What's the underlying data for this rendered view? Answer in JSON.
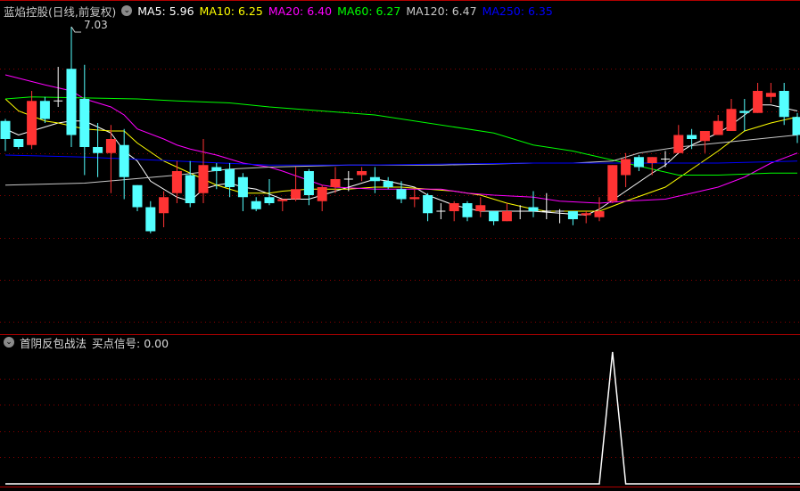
{
  "header": {
    "title": "蓝焰控股(日线,前复权)",
    "ma": [
      {
        "label": "MA5: 5.96",
        "color": "#ffffff"
      },
      {
        "label": "MA10: 6.25",
        "color": "#ffff00"
      },
      {
        "label": "MA20: 6.40",
        "color": "#ff00ff"
      },
      {
        "label": "MA60: 6.27",
        "color": "#00ff00"
      },
      {
        "label": "MA120: 6.47",
        "color": "#c8c8c8"
      },
      {
        "label": "MA250: 6.35",
        "color": "#0000ff"
      }
    ]
  },
  "high_marker": "7.03",
  "indicator": {
    "name": "首阴反包战法",
    "signal_label": "买点信号: 0.00",
    "signal_index": 46
  },
  "colors": {
    "up": "#ff3333",
    "down": "#54ffff",
    "doji": "#ffffff",
    "grid": "#8b0000",
    "divider": "#b00000"
  },
  "chart_data": {
    "type": "candlestick",
    "ylim": [
      5.97,
      7.1
    ],
    "candles": [
      [
        6.56,
        6.57,
        6.41,
        6.47
      ],
      [
        6.47,
        6.47,
        6.42,
        6.43
      ],
      [
        6.44,
        6.71,
        6.42,
        6.66
      ],
      [
        6.66,
        6.68,
        6.55,
        6.57
      ],
      [
        6.66,
        6.83,
        6.63,
        6.66
      ],
      [
        6.82,
        7.03,
        6.43,
        6.49
      ],
      [
        6.67,
        6.84,
        6.29,
        6.43
      ],
      [
        6.43,
        6.55,
        6.28,
        6.4
      ],
      [
        6.4,
        6.54,
        6.2,
        6.47
      ],
      [
        6.44,
        6.52,
        6.17,
        6.28
      ],
      [
        6.24,
        6.24,
        6.11,
        6.13
      ],
      [
        6.13,
        6.16,
        6.0,
        6.01
      ],
      [
        6.1,
        6.21,
        6.03,
        6.18
      ],
      [
        6.2,
        6.36,
        6.15,
        6.31
      ],
      [
        6.29,
        6.36,
        6.13,
        6.15
      ],
      [
        6.2,
        6.47,
        6.15,
        6.34
      ],
      [
        6.33,
        6.35,
        6.22,
        6.31
      ],
      [
        6.32,
        6.35,
        6.18,
        6.23
      ],
      [
        6.28,
        6.3,
        6.11,
        6.18
      ],
      [
        6.16,
        6.18,
        6.11,
        6.12
      ],
      [
        6.18,
        6.27,
        6.14,
        6.15
      ],
      [
        6.16,
        6.17,
        6.11,
        6.17
      ],
      [
        6.17,
        6.33,
        6.16,
        6.22
      ],
      [
        6.31,
        6.32,
        6.14,
        6.19
      ],
      [
        6.16,
        6.24,
        6.11,
        6.23
      ],
      [
        6.23,
        6.33,
        6.2,
        6.27
      ],
      [
        6.27,
        6.31,
        6.21,
        6.27
      ],
      [
        6.29,
        6.33,
        6.26,
        6.31
      ],
      [
        6.28,
        6.33,
        6.2,
        6.26
      ],
      [
        6.26,
        6.28,
        6.22,
        6.23
      ],
      [
        6.22,
        6.26,
        6.15,
        6.17
      ],
      [
        6.17,
        6.22,
        6.13,
        6.18
      ],
      [
        6.19,
        6.2,
        6.06,
        6.1
      ],
      [
        6.11,
        6.15,
        6.07,
        6.11
      ],
      [
        6.11,
        6.16,
        6.06,
        6.15
      ],
      [
        6.15,
        6.16,
        6.06,
        6.08
      ],
      [
        6.11,
        6.18,
        6.08,
        6.14
      ],
      [
        6.11,
        6.11,
        6.04,
        6.06
      ],
      [
        6.06,
        6.15,
        6.06,
        6.11
      ],
      [
        6.11,
        6.14,
        6.07,
        6.11
      ],
      [
        6.13,
        6.21,
        6.08,
        6.11
      ],
      [
        6.11,
        6.2,
        6.07,
        6.11
      ],
      [
        6.11,
        6.12,
        6.05,
        6.11
      ],
      [
        6.11,
        6.11,
        6.04,
        6.07
      ],
      [
        6.09,
        6.11,
        6.05,
        6.1
      ],
      [
        6.08,
        6.18,
        6.06,
        6.11
      ],
      [
        6.16,
        6.34,
        6.15,
        6.34
      ],
      [
        6.29,
        6.4,
        6.23,
        6.37
      ],
      [
        6.38,
        6.39,
        6.31,
        6.33
      ],
      [
        6.35,
        6.38,
        6.29,
        6.38
      ],
      [
        6.37,
        6.41,
        6.33,
        6.37
      ],
      [
        6.4,
        6.54,
        6.4,
        6.49
      ],
      [
        6.49,
        6.52,
        6.42,
        6.47
      ],
      [
        6.46,
        6.51,
        6.4,
        6.51
      ],
      [
        6.49,
        6.59,
        6.49,
        6.56
      ],
      [
        6.51,
        6.67,
        6.51,
        6.62
      ],
      [
        6.61,
        6.67,
        6.51,
        6.6
      ],
      [
        6.6,
        6.75,
        6.6,
        6.71
      ],
      [
        6.68,
        6.75,
        6.65,
        6.7
      ],
      [
        6.71,
        6.75,
        6.54,
        6.58
      ],
      [
        6.58,
        6.6,
        6.45,
        6.49
      ]
    ],
    "ma_series": [
      {
        "name": "MA5",
        "color": "#ffffff",
        "points": [
          [
            0,
            6.52
          ],
          [
            1,
            6.49
          ],
          [
            2,
            6.51
          ],
          [
            4,
            6.55
          ],
          [
            5,
            6.56
          ],
          [
            6,
            6.56
          ],
          [
            7,
            6.53
          ],
          [
            8,
            6.5
          ],
          [
            9,
            6.41
          ],
          [
            10,
            6.36
          ],
          [
            11,
            6.26
          ],
          [
            13,
            6.18
          ],
          [
            14,
            6.16
          ],
          [
            15,
            6.22
          ],
          [
            16,
            6.24
          ],
          [
            17,
            6.25
          ],
          [
            18,
            6.23
          ],
          [
            19,
            6.22
          ],
          [
            21,
            6.17
          ],
          [
            23,
            6.17
          ],
          [
            25,
            6.21
          ],
          [
            26,
            6.23
          ],
          [
            28,
            6.27
          ],
          [
            29,
            6.26
          ],
          [
            31,
            6.23
          ],
          [
            32,
            6.19
          ],
          [
            34,
            6.14
          ],
          [
            36,
            6.11
          ],
          [
            38,
            6.11
          ],
          [
            40,
            6.11
          ],
          [
            42,
            6.1
          ],
          [
            44,
            6.09
          ],
          [
            45,
            6.12
          ],
          [
            47,
            6.21
          ],
          [
            49,
            6.3
          ],
          [
            50,
            6.34
          ],
          [
            51,
            6.4
          ],
          [
            52,
            6.44
          ],
          [
            54,
            6.5
          ],
          [
            55,
            6.54
          ],
          [
            57,
            6.64
          ],
          [
            58,
            6.64
          ],
          [
            60,
            6.61
          ]
        ]
      },
      {
        "name": "MA10",
        "color": "#ffff00",
        "points": [
          [
            0,
            6.67
          ],
          [
            1,
            6.61
          ],
          [
            3,
            6.56
          ],
          [
            4,
            6.55
          ],
          [
            6,
            6.52
          ],
          [
            8,
            6.51
          ],
          [
            9,
            6.51
          ],
          [
            10,
            6.45
          ],
          [
            12,
            6.36
          ],
          [
            13,
            6.33
          ],
          [
            14,
            6.3
          ],
          [
            16,
            6.24
          ],
          [
            17,
            6.22
          ],
          [
            18,
            6.2
          ],
          [
            20,
            6.2
          ],
          [
            21,
            6.21
          ],
          [
            23,
            6.22
          ],
          [
            26,
            6.22
          ],
          [
            28,
            6.23
          ],
          [
            30,
            6.23
          ],
          [
            32,
            6.22
          ],
          [
            34,
            6.21
          ],
          [
            36,
            6.19
          ],
          [
            38,
            6.15
          ],
          [
            40,
            6.12
          ],
          [
            41,
            6.11
          ],
          [
            45,
            6.11
          ],
          [
            47,
            6.16
          ],
          [
            50,
            6.23
          ],
          [
            52,
            6.32
          ],
          [
            54,
            6.41
          ],
          [
            56,
            6.51
          ],
          [
            58,
            6.55
          ],
          [
            60,
            6.58
          ]
        ]
      },
      {
        "name": "MA20",
        "color": "#ff00ff",
        "points": [
          [
            0,
            6.79
          ],
          [
            3,
            6.74
          ],
          [
            5,
            6.71
          ],
          [
            6,
            6.67
          ],
          [
            8,
            6.63
          ],
          [
            9,
            6.59
          ],
          [
            10,
            6.52
          ],
          [
            12,
            6.47
          ],
          [
            13,
            6.44
          ],
          [
            14,
            6.42
          ],
          [
            16,
            6.39
          ],
          [
            17,
            6.37
          ],
          [
            18,
            6.35
          ],
          [
            20,
            6.33
          ],
          [
            21,
            6.31
          ],
          [
            24,
            6.24
          ],
          [
            25,
            6.23
          ],
          [
            28,
            6.22
          ],
          [
            30,
            6.22
          ],
          [
            33,
            6.22
          ],
          [
            35,
            6.2
          ],
          [
            37,
            6.19
          ],
          [
            40,
            6.18
          ],
          [
            42,
            6.16
          ],
          [
            45,
            6.15
          ],
          [
            47,
            6.16
          ],
          [
            50,
            6.17
          ],
          [
            52,
            6.2
          ],
          [
            54,
            6.23
          ],
          [
            56,
            6.28
          ],
          [
            58,
            6.35
          ],
          [
            60,
            6.4
          ]
        ]
      },
      {
        "name": "MA60",
        "color": "#00ff00",
        "points": [
          [
            0,
            6.67
          ],
          [
            2,
            6.68
          ],
          [
            10,
            6.67
          ],
          [
            13,
            6.66
          ],
          [
            17,
            6.65
          ],
          [
            20,
            6.63
          ],
          [
            28,
            6.59
          ],
          [
            37,
            6.5
          ],
          [
            40,
            6.44
          ],
          [
            43,
            6.41
          ],
          [
            47,
            6.35
          ],
          [
            51,
            6.29
          ],
          [
            54,
            6.29
          ],
          [
            58,
            6.3
          ],
          [
            60,
            6.3
          ]
        ]
      },
      {
        "name": "MA120",
        "color": "#c8c8c8",
        "points": [
          [
            0,
            6.24
          ],
          [
            6,
            6.25
          ],
          [
            13,
            6.29
          ],
          [
            17,
            6.32
          ],
          [
            20,
            6.33
          ],
          [
            26,
            6.34
          ],
          [
            33,
            6.34
          ],
          [
            40,
            6.35
          ],
          [
            43,
            6.35
          ],
          [
            46,
            6.36
          ],
          [
            48,
            6.4
          ],
          [
            51,
            6.43
          ],
          [
            54,
            6.45
          ],
          [
            57,
            6.47
          ],
          [
            60,
            6.49
          ]
        ]
      },
      {
        "name": "MA250",
        "color": "#0000ff",
        "points": [
          [
            0,
            6.39
          ],
          [
            6,
            6.38
          ],
          [
            13,
            6.36
          ],
          [
            20,
            6.34
          ],
          [
            27,
            6.34
          ],
          [
            40,
            6.35
          ],
          [
            47,
            6.35
          ],
          [
            54,
            6.35
          ],
          [
            60,
            6.36
          ]
        ]
      }
    ],
    "signal_ylim": [
      0,
      1
    ]
  }
}
